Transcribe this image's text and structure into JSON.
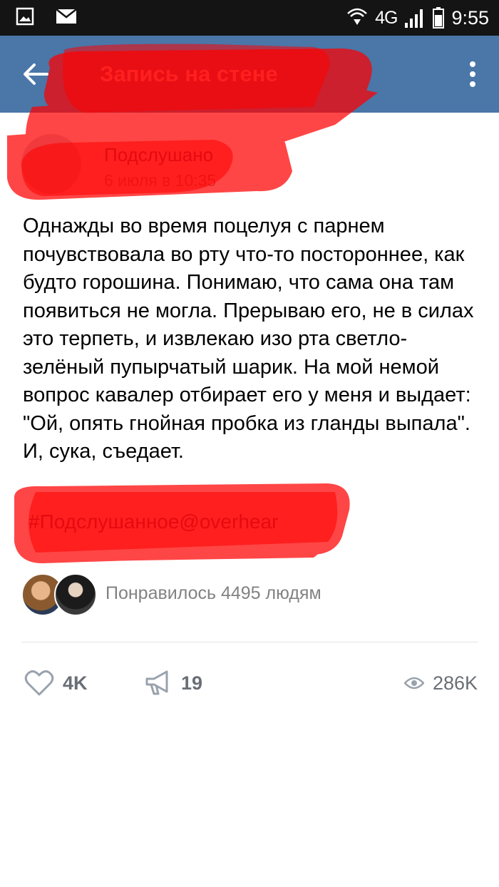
{
  "status_bar": {
    "network": "4G",
    "time": "9:55",
    "icons": [
      "image-icon",
      "mail-icon",
      "hotspot-icon",
      "signal-icon",
      "battery-icon"
    ]
  },
  "toolbar": {
    "title": "Запись на стене",
    "back_icon": "arrow-left-icon",
    "more_icon": "more-vertical-icon",
    "color": "#4a76a8"
  },
  "post": {
    "author_name": "Подслушано",
    "date": "6 июля в 10:35",
    "text": "Однажды во время поцелуя с парнем\nпочувствовала во рту что-то постороннее, как\nбудто горошина. Понимаю, что сама она там\nпоявиться не могла. Прерываю его, не в силах\nэто терпеть, и извлекаю изо рта светло-\nзелёный пупырчатый шарик. На мой немой\nвопрос кавалер отбирает его у меня и выдает:\n\"Ой, опять гнойная пробка из гланды выпала\".\nИ, сука, съедает.",
    "hashtag": "#Подслушанное@overhear"
  },
  "likes": {
    "text": "Понравилось 4495 людям"
  },
  "actions": {
    "likes": "4K",
    "shares": "19",
    "views": "286K",
    "like_icon": "heart-icon",
    "share_icon": "megaphone-icon",
    "views_icon": "eye-icon"
  },
  "colors": {
    "censor": "#ff0000",
    "link": "#2a5885",
    "secondary": "#828282"
  }
}
